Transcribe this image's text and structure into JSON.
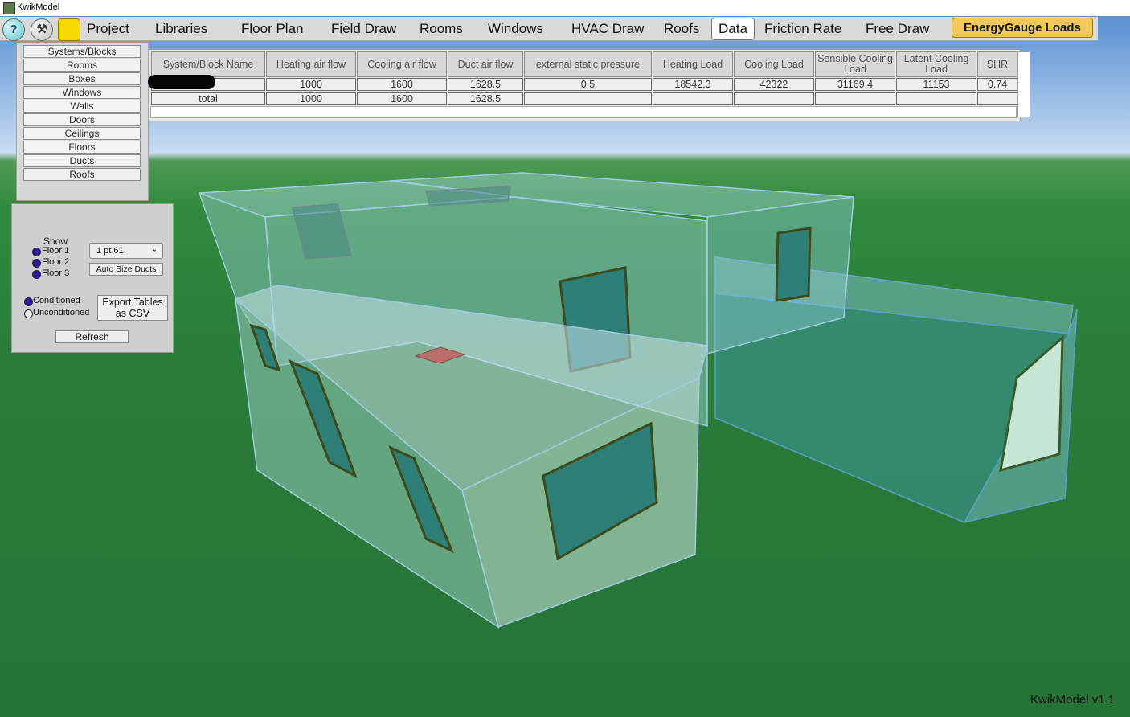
{
  "window": {
    "title": "KwikModel"
  },
  "toolbar": {
    "help_label": "?",
    "wrench_label": "⚒"
  },
  "menu": [
    {
      "label": "Project",
      "active": false
    },
    {
      "label": "Libraries",
      "active": false
    },
    {
      "label": "Floor Plan",
      "active": false
    },
    {
      "label": "Field Draw",
      "active": false
    },
    {
      "label": "Rooms",
      "active": false
    },
    {
      "label": "Windows",
      "active": false
    },
    {
      "label": "HVAC Draw",
      "active": false
    },
    {
      "label": "Roofs",
      "active": false
    },
    {
      "label": "Data",
      "active": true
    },
    {
      "label": "Friction Rate",
      "active": false
    },
    {
      "label": "Free Draw",
      "active": false
    },
    {
      "label": "EnergyGauge Loads",
      "active": false
    }
  ],
  "data_categories": [
    "Systems/Blocks",
    "Rooms",
    "Boxes",
    "Windows",
    "Walls",
    "Doors",
    "Ceilings",
    "Floors",
    "Ducts",
    "Roofs"
  ],
  "table": {
    "headers": [
      "System/Block Name",
      "Heating air flow",
      "Cooling air flow",
      "Duct air flow",
      "external static pressure",
      "Heating Load",
      "Cooling Load",
      "Sensible Cooling Load",
      "Latent Cooling Load",
      "SHR"
    ],
    "rows": [
      [
        "",
        "1000",
        "1600",
        "1628.5",
        "0.5",
        "18542.3",
        "42322",
        "31169.4",
        "11153",
        "0.74"
      ],
      [
        "total",
        "1000",
        "1600",
        "1628.5",
        "",
        "",
        "",
        "",
        "",
        ""
      ]
    ]
  },
  "show_panel": {
    "show_label": "Show",
    "floors": [
      {
        "label": "Floor 1",
        "selected": true
      },
      {
        "label": "Floor 2",
        "selected": true
      },
      {
        "label": "Floor 3",
        "selected": true
      }
    ],
    "size_select": "1 pt 61",
    "auto_size_label": "Auto Size Ducts",
    "filters": [
      {
        "label": "Conditioned",
        "selected": true
      },
      {
        "label": "Unconditioned",
        "selected": false
      }
    ],
    "export_label": "Export Tables as CSV",
    "refresh_label": "Refresh"
  },
  "version": "KwikModel v1.1",
  "colors": {
    "ground": "#2a7d3a",
    "accent_button": "#f0c95a",
    "yellow_button": "#f5d800",
    "radio_selected": "#2d1aa0"
  }
}
